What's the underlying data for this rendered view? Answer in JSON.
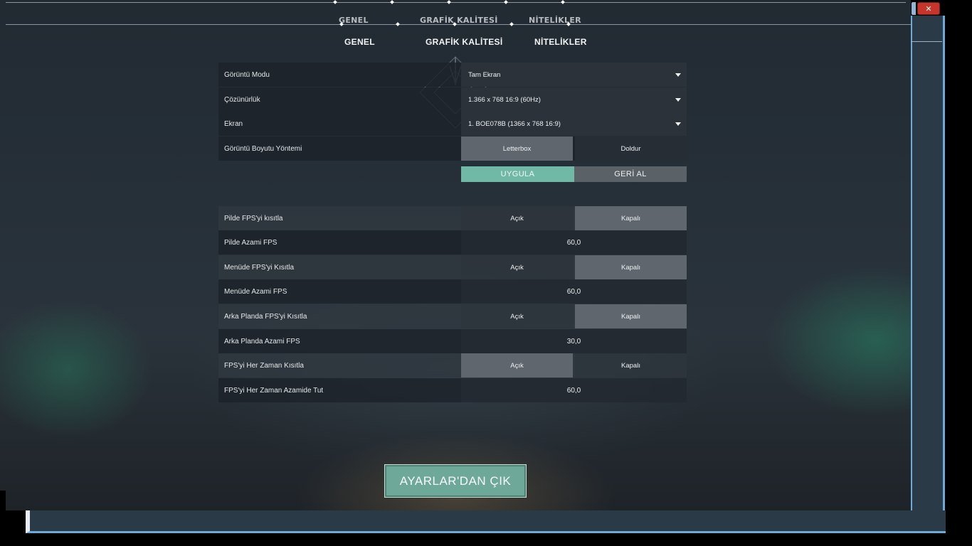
{
  "window": {
    "close_label": "✕"
  },
  "ghost_header": {
    "tabs": [
      "GENEL",
      "GRAFİK KALİTESİ",
      "NİTELİKLER"
    ]
  },
  "tabs": [
    "GENEL",
    "GRAFİK KALİTESİ",
    "NİTELİKLER"
  ],
  "display": {
    "mode": {
      "label": "Görüntü Modu",
      "value": "Tam Ekran"
    },
    "resolution": {
      "label": "Çözünürlük",
      "value": "1.366 x 768 16:9 (60Hz)"
    },
    "monitor": {
      "label": "Ekran",
      "value": "1. BOE078B (1366 x  768 16:9)"
    },
    "aspect": {
      "label": "Görüntü Boyutu Yöntemi",
      "options": [
        "Letterbox",
        "Doldur"
      ],
      "selected": "Letterbox"
    },
    "apply_label": "UYGULA",
    "revert_label": "GERİ AL"
  },
  "fps": {
    "battery_limit": {
      "label": "Pilde FPS'yi kısıtla",
      "options": [
        "Açık",
        "Kapalı"
      ],
      "selected": "Kapalı"
    },
    "battery_max": {
      "label": "Pilde Azami FPS",
      "value": "60,0"
    },
    "menu_limit": {
      "label": "Menüde FPS'yi Kısıtla",
      "options": [
        "Açık",
        "Kapalı"
      ],
      "selected": "Kapalı"
    },
    "menu_max": {
      "label": "Menüde Azami FPS",
      "value": "60,0"
    },
    "background_limit": {
      "label": "Arka Planda FPS'yi Kısıtla",
      "options": [
        "Açık",
        "Kapalı"
      ],
      "selected": "Kapalı"
    },
    "background_max": {
      "label": "Arka Planda Azami FPS",
      "value": "30,0"
    },
    "always_limit": {
      "label": "FPS'yi Her Zaman Kısıtla",
      "options": [
        "Açık",
        "Kapalı"
      ],
      "selected": "Açık"
    },
    "always_max": {
      "label": "FPS'yi Her Zaman Azamide Tut",
      "value": "60,0"
    }
  },
  "exit_label": "AYARLAR'DAN ÇIK",
  "colors": {
    "accent": "#6fb9a6",
    "selected_segment": "#5f666d",
    "close_red": "#c5352c"
  }
}
